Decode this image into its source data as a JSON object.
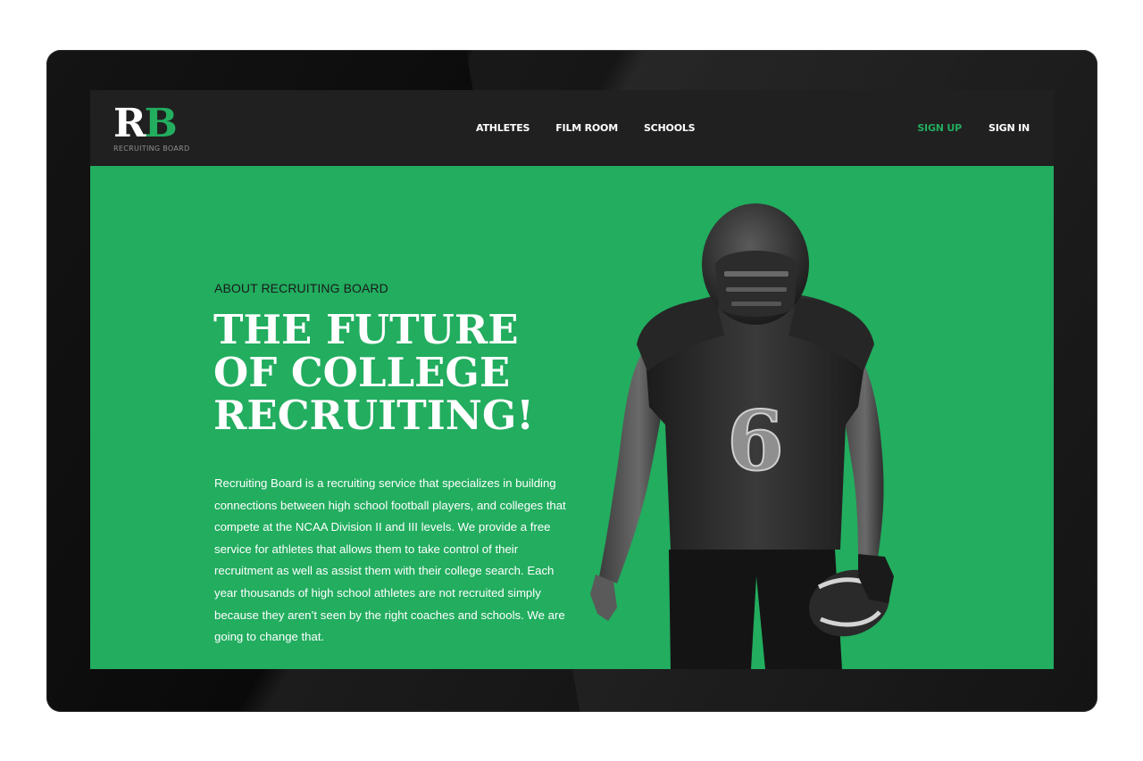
{
  "brand": {
    "logo_letters_r": "R",
    "logo_letters_b": "B",
    "logo_subtitle": "RECRUITING BOARD",
    "accent_color": "#22ad5f",
    "navbar_color": "#202020"
  },
  "nav": {
    "items": [
      {
        "label": "ATHLETES"
      },
      {
        "label": "FILM ROOM"
      },
      {
        "label": "SCHOOLS"
      }
    ],
    "sign_up": "SIGN UP",
    "sign_in": "SIGN IN"
  },
  "hero": {
    "eyebrow": "ABOUT RECRUITING BOARD",
    "headline_lines": [
      "THE FUTURE",
      "OF COLLEGE",
      "RECRUITING!"
    ],
    "body": "Recruiting Board is a recruiting service that specializes in building connections between high school football players, and colleges that compete at the NCAA Division II and III levels. We provide a free service for athletes that allows them to take control of their recruitment as well as assist them with their college search. Each year thousands of high school athletes are not recruited simply because they aren’t seen by the right coaches and schools. We are going to change that.",
    "jersey_number": "6",
    "image_icon": "football-player-illustration"
  }
}
